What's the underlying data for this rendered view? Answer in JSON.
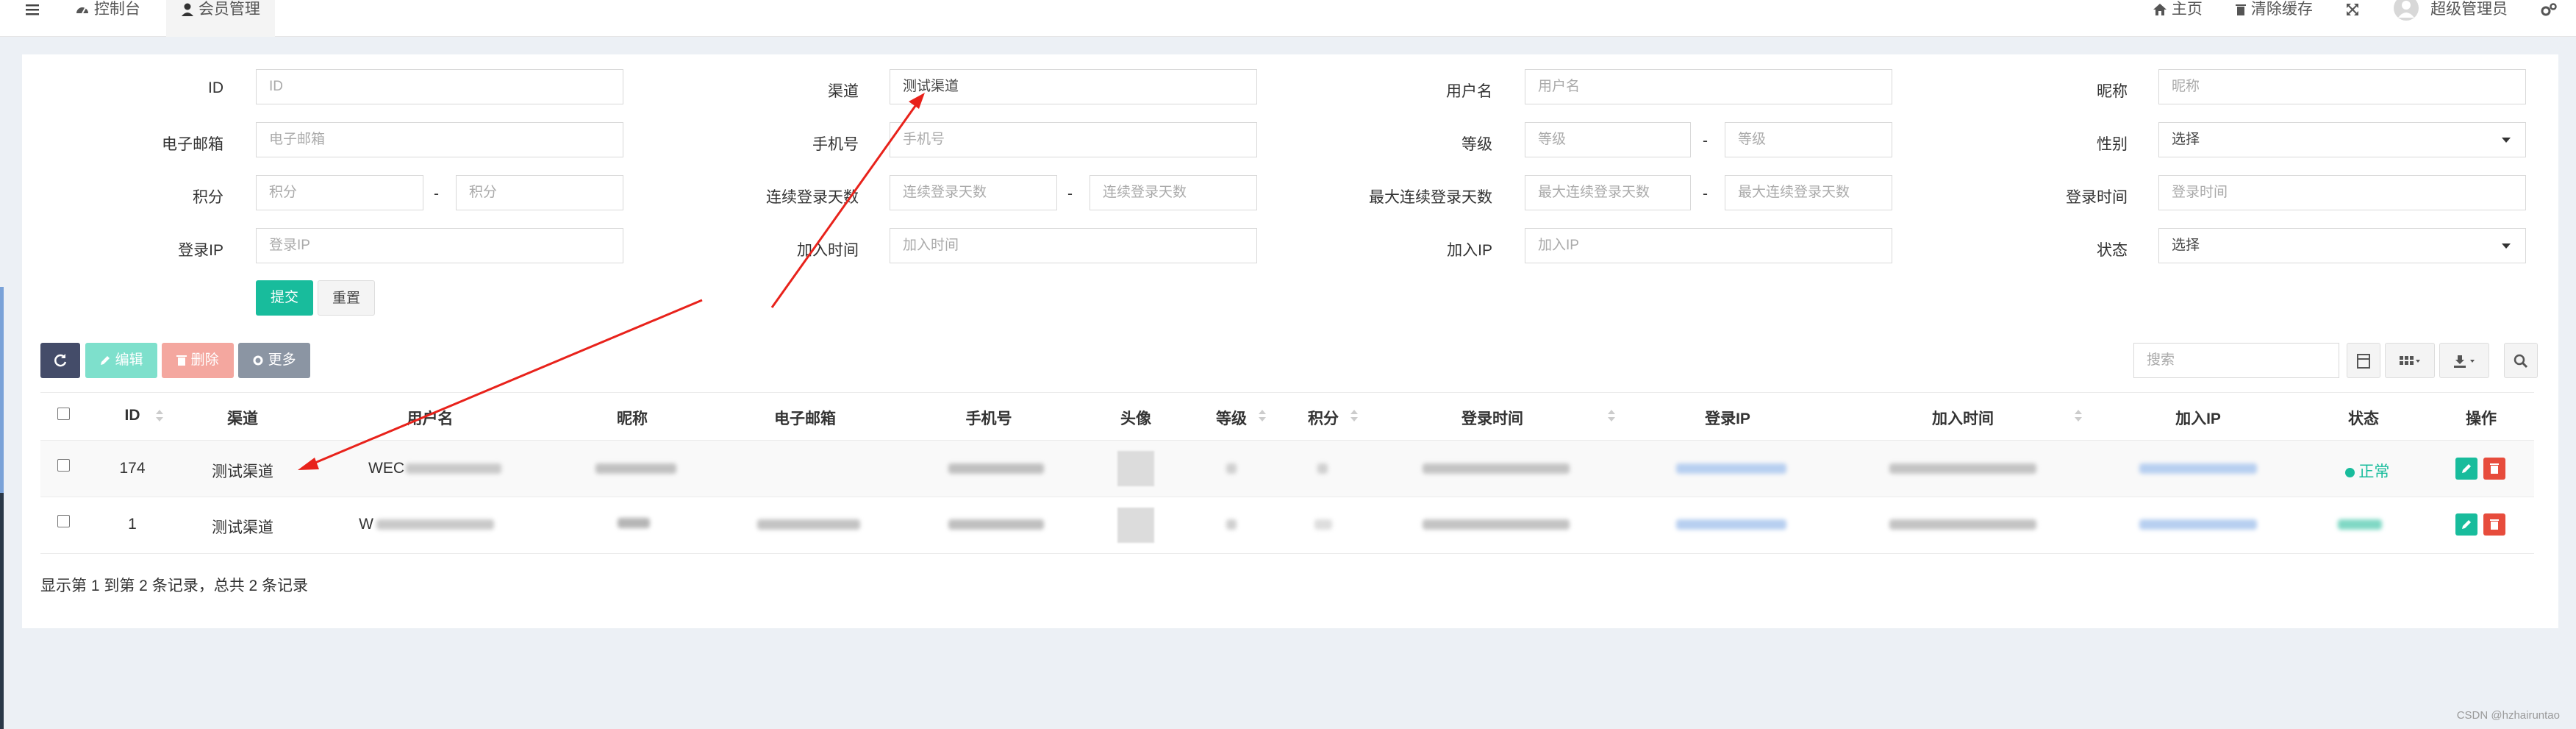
{
  "topbar": {
    "dashboard": "控制台",
    "members_tab": "会员管理",
    "home": "主页",
    "clear_cache": "清除缓存",
    "admin": "超级管理员"
  },
  "filters": {
    "id": {
      "label": "ID",
      "placeholder": "ID"
    },
    "channel": {
      "label": "渠道",
      "value": "测试渠道"
    },
    "username": {
      "label": "用户名",
      "placeholder": "用户名"
    },
    "nickname": {
      "label": "昵称",
      "placeholder": "昵称"
    },
    "email": {
      "label": "电子邮箱",
      "placeholder": "电子邮箱"
    },
    "mobile": {
      "label": "手机号",
      "placeholder": "手机号"
    },
    "level": {
      "label": "等级",
      "placeholder": "等级"
    },
    "gender": {
      "label": "性别",
      "value": "选择"
    },
    "score": {
      "label": "积分",
      "placeholder": "积分"
    },
    "successions": {
      "label": "连续登录天数",
      "placeholder": "连续登录天数"
    },
    "maxsuccessions": {
      "label": "最大连续登录天数",
      "placeholder": "最大连续登录天数"
    },
    "logintime": {
      "label": "登录时间",
      "placeholder": "登录时间"
    },
    "loginip": {
      "label": "登录IP",
      "placeholder": "登录IP"
    },
    "jointime": {
      "label": "加入时间",
      "placeholder": "加入时间"
    },
    "joinip": {
      "label": "加入IP",
      "placeholder": "加入IP"
    },
    "status": {
      "label": "状态",
      "value": "选择"
    },
    "range_sep": "-",
    "submit": "提交",
    "reset": "重置"
  },
  "toolbar": {
    "edit": "编辑",
    "delete": "删除",
    "more": "更多",
    "search_placeholder": "搜索"
  },
  "table": {
    "headers": [
      "ID",
      "渠道",
      "用户名",
      "昵称",
      "电子邮箱",
      "手机号",
      "头像",
      "等级",
      "积分",
      "登录时间",
      "登录IP",
      "加入时间",
      "加入IP",
      "状态",
      "操作"
    ],
    "rows": [
      {
        "id": "174",
        "channel": "测试渠道",
        "username_prefix": "WEC",
        "status": "正常"
      },
      {
        "id": "1",
        "channel": "测试渠道",
        "username_prefix": "W",
        "status": ""
      }
    ]
  },
  "footer": {
    "summary": "显示第 1 到第 2 条记录，总共 2 条记录"
  },
  "credit": "CSDN @hzhairuntao",
  "colors": {
    "accent": "#18bc9c",
    "danger": "#e74c3c",
    "primary_dark": "#444c69",
    "arrow": "#e8221b"
  }
}
